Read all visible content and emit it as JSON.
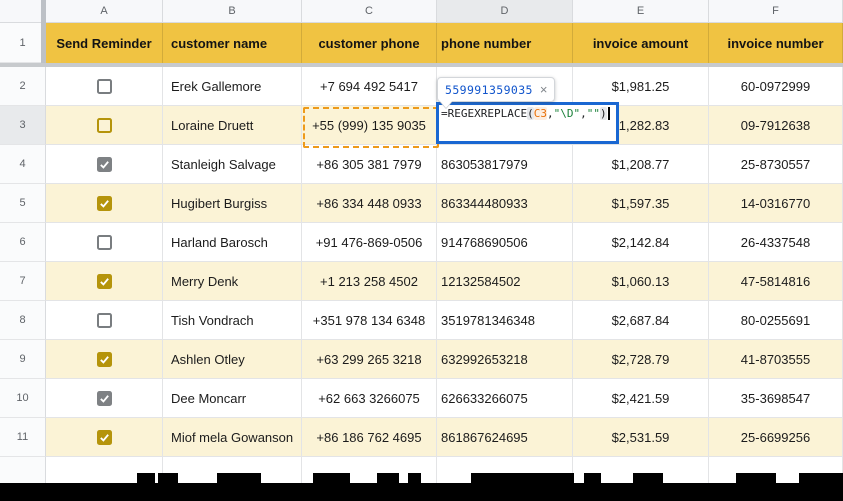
{
  "sheet": {
    "column_letters": [
      "A",
      "B",
      "C",
      "D",
      "E",
      "F"
    ],
    "active_column_letter": "D",
    "active_row_number": "3",
    "row_numbers": [
      "1",
      "2",
      "3",
      "4",
      "5",
      "6",
      "7",
      "8",
      "9",
      "10",
      "11"
    ]
  },
  "header_row": {
    "send_reminder": "Send Reminder",
    "customer_name": "customer name",
    "customer_phone": "customer phone",
    "phone_number": "phone number",
    "invoice_amount": "invoice amount",
    "invoice_number": "invoice number"
  },
  "rows": [
    {
      "row": "2",
      "checked": false,
      "name": "Erek Gallemore",
      "phone": "+7 694 492 5417",
      "digits": "",
      "amount": "$1,981.25",
      "invoice": "60-0972999"
    },
    {
      "row": "3",
      "checked": false,
      "name": "Loraine Druett",
      "phone": "+55 (999) 135 9035",
      "digits": "",
      "amount": "$1,282.83",
      "invoice": "09-7912638"
    },
    {
      "row": "4",
      "checked": true,
      "name": "Stanleigh Salvage",
      "phone": "+86 305 381 7979",
      "digits": "863053817979",
      "amount": "$1,208.77",
      "invoice": "25-8730557"
    },
    {
      "row": "5",
      "checked": true,
      "name": "Hugibert Burgiss",
      "phone": "+86 334 448 0933",
      "digits": "863344480933",
      "amount": "$1,597.35",
      "invoice": "14-0316770"
    },
    {
      "row": "6",
      "checked": false,
      "name": "Harland Barosch",
      "phone": "+91 476-869-0506",
      "digits": "914768690506",
      "amount": "$2,142.84",
      "invoice": "26-4337548"
    },
    {
      "row": "7",
      "checked": true,
      "name": "Merry Denk",
      "phone": "+1 213 258 4502",
      "digits": "12132584502",
      "amount": "$1,060.13",
      "invoice": "47-5814816"
    },
    {
      "row": "8",
      "checked": false,
      "name": "Tish Vondrach",
      "phone": "+351 978 134 6348",
      "digits": "3519781346348",
      "amount": "$2,687.84",
      "invoice": "80-0255691"
    },
    {
      "row": "9",
      "checked": true,
      "name": "Ashlen Otley",
      "phone": "+63 299 265 3218",
      "digits": "632992653218",
      "amount": "$2,728.79",
      "invoice": "41-8703555"
    },
    {
      "row": "10",
      "checked": true,
      "name": "Dee Moncarr",
      "phone": "+62 663 3266075",
      "digits": "626633266075",
      "amount": "$2,421.59",
      "invoice": "35-3698547"
    },
    {
      "row": "11",
      "checked": true,
      "name": "Miof mela Gowanson",
      "phone": "+86 186 762 4695",
      "digits": "861867624695",
      "amount": "$2,531.59",
      "invoice": "25-6699256"
    }
  ],
  "formula_editor": {
    "cell": "D3",
    "referenced_cell": "C3",
    "tokens": [
      {
        "text": "=REGEXREPLACE",
        "kind": "default"
      },
      {
        "text": "(",
        "kind": "default",
        "paren_highlight": true
      },
      {
        "text": "C3",
        "kind": "reference"
      },
      {
        "text": ",",
        "kind": "default"
      },
      {
        "text": "\"\\D\"",
        "kind": "string"
      },
      {
        "text": ",",
        "kind": "default"
      },
      {
        "text": "\"\"",
        "kind": "string"
      },
      {
        "text": ")",
        "kind": "default",
        "paren_highlight": true
      }
    ]
  },
  "result_preview": {
    "value": "559991359035",
    "close_icon": "×"
  },
  "colors": {
    "header-gold": "#F0C342",
    "band-yellow": "#FBF3D6",
    "edit-border-blue": "#1967D2",
    "chip-blue": "#1155CC",
    "ref-dash-orange": "#ED9A1B",
    "token-reference-orange": "#E8710A",
    "token-string-green": "#188038",
    "checkbox-gold": "#B5940B",
    "checkbox-gray": "#7E8184"
  }
}
